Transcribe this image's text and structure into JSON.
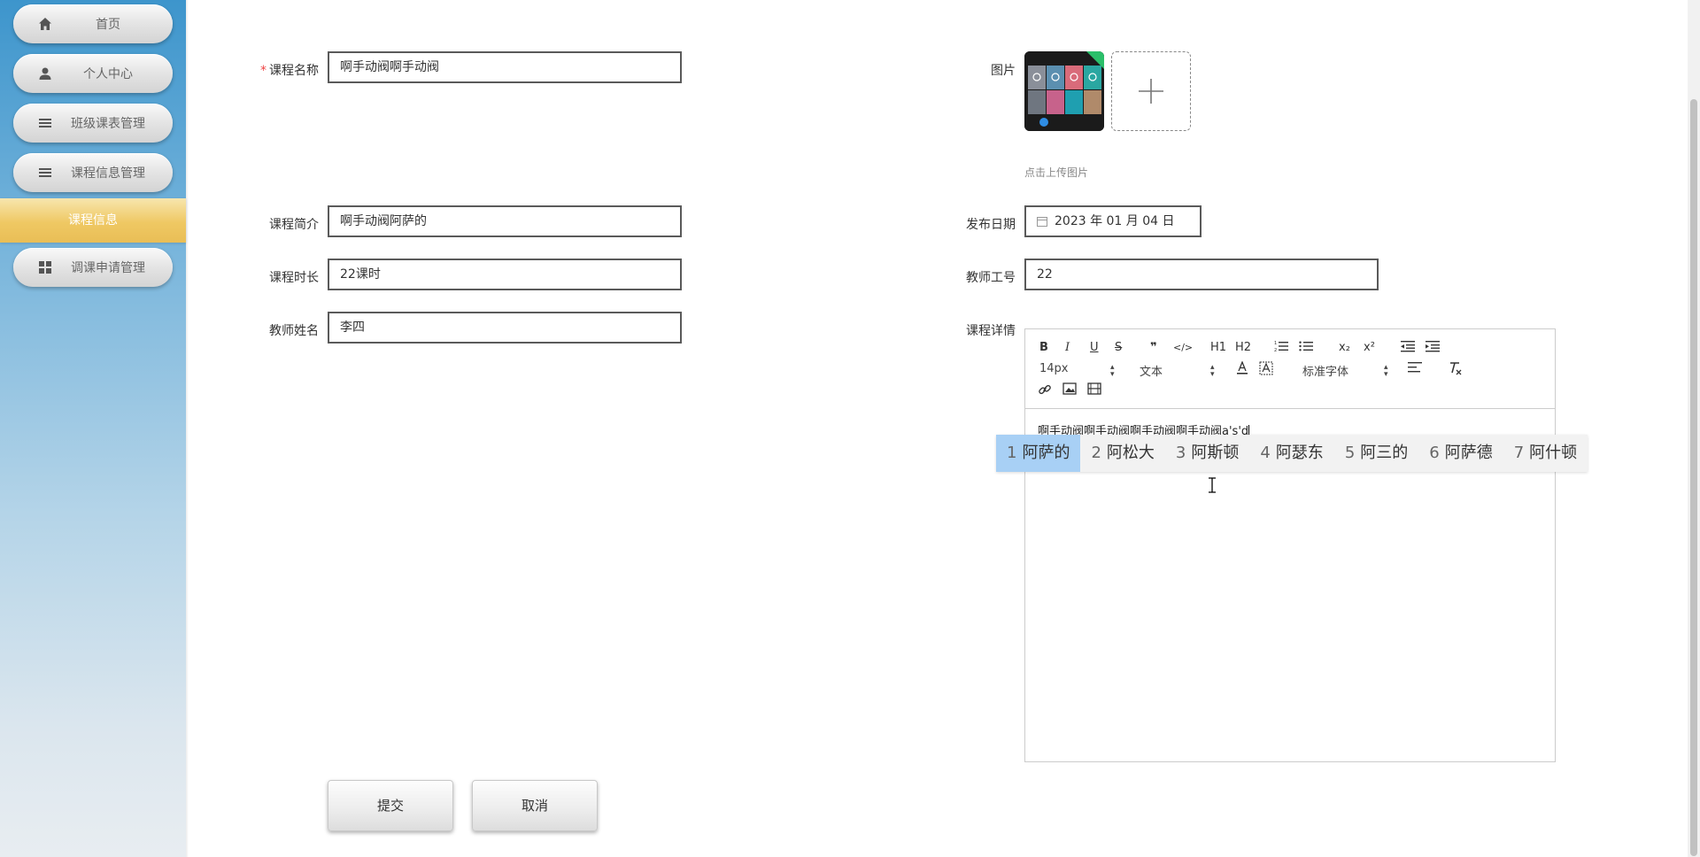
{
  "sidebar": {
    "items": [
      {
        "label": "首页",
        "icon": "home-icon"
      },
      {
        "label": "个人中心",
        "icon": "user-icon"
      },
      {
        "label": "班级课表管理",
        "icon": "menu-icon"
      },
      {
        "label": "课程信息管理",
        "icon": "menu-icon"
      }
    ],
    "sub_item": "课程信息",
    "last_item": {
      "label": "调课申请管理",
      "icon": "grid-icon"
    }
  },
  "form": {
    "course_name": {
      "label": "课程名称",
      "required_mark": "*",
      "value": "啊手动阀啊手动阀"
    },
    "picture": {
      "label": "图片",
      "hint": "点击上传图片",
      "upload_icon": "plus-icon"
    },
    "intro": {
      "label": "课程简介",
      "value": "啊手动阀阿萨的"
    },
    "publish_date": {
      "label": "发布日期",
      "value": "2023 年 01 月 04 日",
      "icon": "calendar-icon"
    },
    "duration": {
      "label": "课程时长",
      "value": "22课时"
    },
    "teacher_id": {
      "label": "教师工号",
      "value": "22"
    },
    "teacher_name": {
      "label": "教师姓名",
      "value": "李四"
    },
    "details": {
      "label": "课程详情"
    }
  },
  "editor": {
    "toolbar": {
      "bold": "B",
      "italic": "I",
      "underline": "U",
      "strike": "S",
      "quote": "❞",
      "code": "</>",
      "h1": "H1",
      "h2": "H2",
      "subscript": "x₂",
      "superscript": "x²",
      "font_size": "14px",
      "block_type": "文本",
      "font_family": "标准字体"
    },
    "content": "啊手动阀啊手动阀啊手动阀啊手动阀",
    "composing": "a's'd"
  },
  "ime": {
    "candidates": [
      {
        "num": "1",
        "text": "阿萨的"
      },
      {
        "num": "2",
        "text": "阿松大"
      },
      {
        "num": "3",
        "text": "阿斯顿"
      },
      {
        "num": "4",
        "text": "阿瑟东"
      },
      {
        "num": "5",
        "text": "阿三的"
      },
      {
        "num": "6",
        "text": "阿萨德"
      },
      {
        "num": "7",
        "text": "阿什顿"
      }
    ],
    "active_index": 0
  },
  "buttons": {
    "submit": "提交",
    "cancel": "取消"
  },
  "colors": {
    "sidebar_top": "#3d95cc",
    "active_nav": "#efc863",
    "ime_highlight": "#a8d0f5"
  }
}
